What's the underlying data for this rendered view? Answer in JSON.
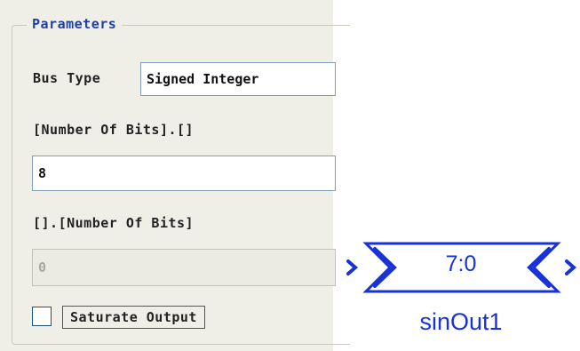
{
  "parameters": {
    "legend": "Parameters",
    "bus_type_label": "Bus Type",
    "bus_type_value": "Signed Integer",
    "int_bits_label": "[Number Of Bits].[]",
    "int_bits_value": "8",
    "frac_bits_label": "[].[Number Of Bits]",
    "frac_bits_value": "0",
    "saturate_label": "Saturate Output",
    "saturate_checked": false
  },
  "block": {
    "value": "7:0",
    "name": "sinOut1",
    "color": "#1732d8"
  }
}
